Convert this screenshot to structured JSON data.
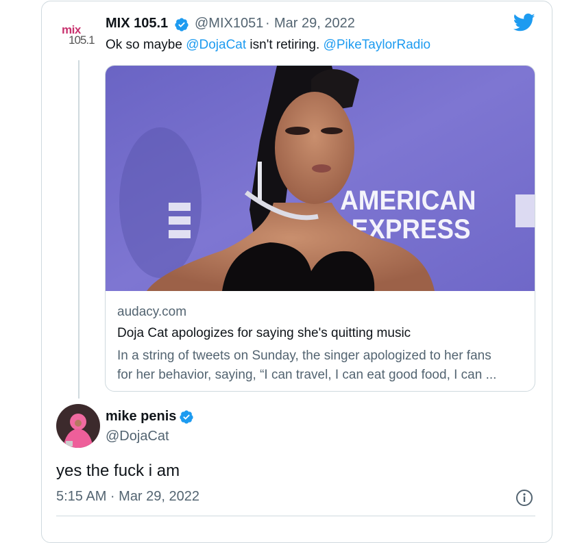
{
  "quoted_tweet": {
    "avatar_line1": "mix",
    "avatar_line2": "105.1",
    "display_name": "MIX 105.1",
    "handle": "@MIX1051",
    "separator": "·",
    "date": "Mar 29, 2022",
    "text_prefix": "Ok so maybe ",
    "mention1": "@DojaCat",
    "text_middle": " isn't retiring. ",
    "mention2": "@PikeTaylorRadio",
    "link_card": {
      "photo_text_line1": "AMERICAN",
      "photo_text_line2": "EXPRESS",
      "domain": "audacy.com",
      "title": "Doja Cat apologizes for saying she's quitting music",
      "description_line1": "In a string of tweets on Sunday, the singer apologized to her fans",
      "description_line2": "for her behavior, saying, “I can travel, I can eat good food, I can ..."
    }
  },
  "reply_tweet": {
    "display_name": "mike penis",
    "handle": "@DojaCat",
    "text": "yes the fuck i am",
    "timestamp": "5:15 AM · Mar 29, 2022"
  },
  "colors": {
    "accent": "#1d9bf0",
    "text": "#0f1419",
    "secondary": "#536471",
    "border": "#cfd9de"
  },
  "icons": [
    "twitter-bird-icon",
    "verified-badge-icon",
    "info-icon"
  ]
}
